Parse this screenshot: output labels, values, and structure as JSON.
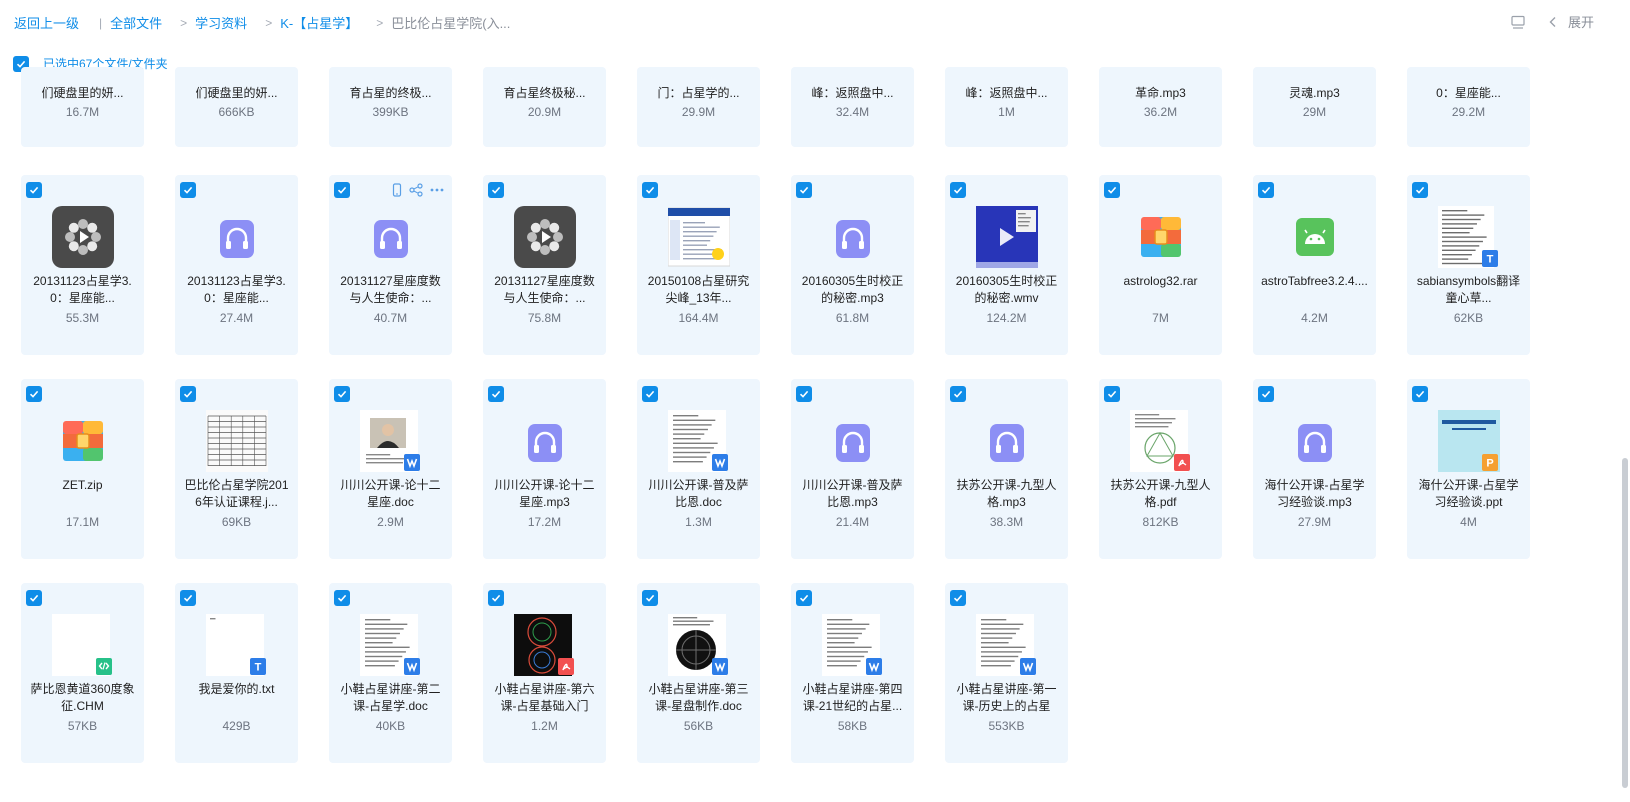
{
  "breadcrumb": {
    "back": "返回上一级",
    "items": [
      "全部文件",
      "学习资料",
      "K-【占星学】"
    ],
    "current": "巴比伦占星学院(入..."
  },
  "header": {
    "expand_label": "展开"
  },
  "selection": {
    "label": "已选中67个文件/文件夹"
  },
  "colors": {
    "accent": "#0f8de8",
    "card_bg": "#eef6fd",
    "checkbox": "#0f8de8"
  },
  "files": [
    {
      "name": "们硬盘里的妍...",
      "size": "16.7M",
      "icon": "partial"
    },
    {
      "name": "们硬盘里的妍...",
      "size": "666KB",
      "icon": "partial"
    },
    {
      "name": "育占星的终极...",
      "size": "399KB",
      "icon": "partial"
    },
    {
      "name": "育占星终极秘...",
      "size": "20.9M",
      "icon": "partial"
    },
    {
      "name": "门：占星学的...",
      "size": "29.9M",
      "icon": "partial"
    },
    {
      "name": "峰：返照盘中...",
      "size": "32.4M",
      "icon": "partial"
    },
    {
      "name": "峰：返照盘中...",
      "size": "1M",
      "icon": "partial"
    },
    {
      "name": "革命.mp3",
      "size": "36.2M",
      "icon": "partial"
    },
    {
      "name": "灵魂.mp3",
      "size": "29M",
      "icon": "partial"
    },
    {
      "name": "0：星座能...",
      "size": "29.2M",
      "icon": "partial"
    },
    {
      "name": "20131123占星学3.0：星座能...",
      "size": "55.3M",
      "icon": "video-icon"
    },
    {
      "name": "20131123占星学3.0：星座能...",
      "size": "27.4M",
      "icon": "audio-icon"
    },
    {
      "name": "20131127星座度数与人生使命：...",
      "size": "40.7M",
      "icon": "audio-icon",
      "hover": true
    },
    {
      "name": "20131127星座度数与人生使命：...",
      "size": "75.8M",
      "icon": "video-icon"
    },
    {
      "name": "20150108占星研究尖峰_13年...",
      "size": "164.4M",
      "icon": "screenshot-thumb"
    },
    {
      "name": "20160305生时校正的秘密.mp3",
      "size": "61.8M",
      "icon": "audio-icon"
    },
    {
      "name": "20160305生时校正的秘密.wmv",
      "size": "124.2M",
      "icon": "video-thumb"
    },
    {
      "name": "astrolog32.rar",
      "size": "7M",
      "icon": "archive-icon"
    },
    {
      "name": "astroTabfree3.2.4....",
      "size": "4.2M",
      "icon": "android-apk-icon"
    },
    {
      "name": "sabiansymbols翻译童心草...",
      "size": "62KB",
      "icon": "txt-doc-thumb"
    },
    {
      "name": "ZET.zip",
      "size": "17.1M",
      "icon": "archive-icon"
    },
    {
      "name": "巴比伦占星学院2016年认证课程.j...",
      "size": "69KB",
      "icon": "table-image-thumb"
    },
    {
      "name": "川川公开课-论十二星座.doc",
      "size": "2.9M",
      "icon": "word-photo-thumb"
    },
    {
      "name": "川川公开课-论十二星座.mp3",
      "size": "17.2M",
      "icon": "audio-icon"
    },
    {
      "name": "川川公开课-普及萨比恩.doc",
      "size": "1.3M",
      "icon": "word-doc-thumb"
    },
    {
      "name": "川川公开课-普及萨比恩.mp3",
      "size": "21.4M",
      "icon": "audio-icon"
    },
    {
      "name": "扶苏公开课-九型人格.mp3",
      "size": "38.3M",
      "icon": "audio-icon"
    },
    {
      "name": "扶苏公开课-九型人格.pdf",
      "size": "812KB",
      "icon": "pdf-diagram-thumb"
    },
    {
      "name": "海什公开课-占星学习经验谈.mp3",
      "size": "27.9M",
      "icon": "audio-icon"
    },
    {
      "name": "海什公开课-占星学习经验谈.ppt",
      "size": "4M",
      "icon": "ppt-slide-thumb"
    },
    {
      "name": "萨比恩黄道360度象征.CHM",
      "size": "57KB",
      "icon": "chm-code-thumb"
    },
    {
      "name": "我是爱你的.txt",
      "size": "429B",
      "icon": "txt-blank-thumb"
    },
    {
      "name": "小鞋占星讲座-第二课-占星学.doc",
      "size": "40KB",
      "icon": "word-doc-thumb"
    },
    {
      "name": "小鞋占星讲座-第六课-占星基础入门",
      "size": "1.2M",
      "icon": "pdf-chart-thumb"
    },
    {
      "name": "小鞋占星讲座-第三课-星盘制作.doc",
      "size": "56KB",
      "icon": "word-chart-thumb"
    },
    {
      "name": "小鞋占星讲座-第四课-21世纪的占星...",
      "size": "58KB",
      "icon": "word-doc-thumb"
    },
    {
      "name": "小鞋占星讲座-第一课-历史上的占星",
      "size": "553KB",
      "icon": "word-doc-thumb"
    }
  ]
}
